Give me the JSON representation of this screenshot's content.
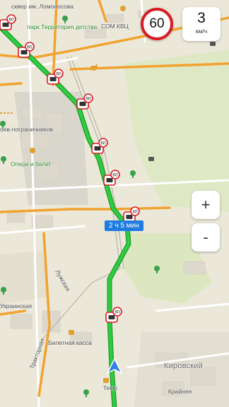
{
  "labels": {
    "lomonosov": "сквер им. Ломоносова",
    "detstva": "парк Территория детства",
    "som": "СОМ КВЦ",
    "pogranichnikov": "оев-пограничников",
    "opera": "Опера и балет",
    "luzhskaya": "Лужская",
    "ukrainskaya": "Украинская",
    "traktornaya": "Тракторная",
    "bilet": "Билетная касса",
    "kirovsky": "Кировский",
    "krainyaya": "Крайняя",
    "temp": "Темп"
  },
  "speed_limit": "60",
  "speed": {
    "value": "3",
    "unit": "км/ч"
  },
  "route": {
    "duration": "2 ч 5 мин"
  },
  "zoom": {
    "in": "+",
    "out": "-"
  },
  "cameras": [
    {
      "limit": "60"
    },
    {
      "limit": "60"
    },
    {
      "limit": "60"
    },
    {
      "limit": "60"
    },
    {
      "limit": "60"
    },
    {
      "limit": "60"
    },
    {
      "limit": "40"
    },
    {
      "limit": "60"
    }
  ],
  "colors": {
    "route_green": "#2ecc40",
    "route_green_dark": "#1e9a2a",
    "road_orange": "#f2a22f",
    "camera_red": "#d81c24",
    "limit_red": "#d81c24",
    "route_label_blue": "#1f7be0",
    "nav_arrow": "#2f7fe6"
  },
  "icons": [
    "camera-icon",
    "tree-icon",
    "horse-icon",
    "bag-icon",
    "theater-icon",
    "navigation-arrow-icon"
  ]
}
